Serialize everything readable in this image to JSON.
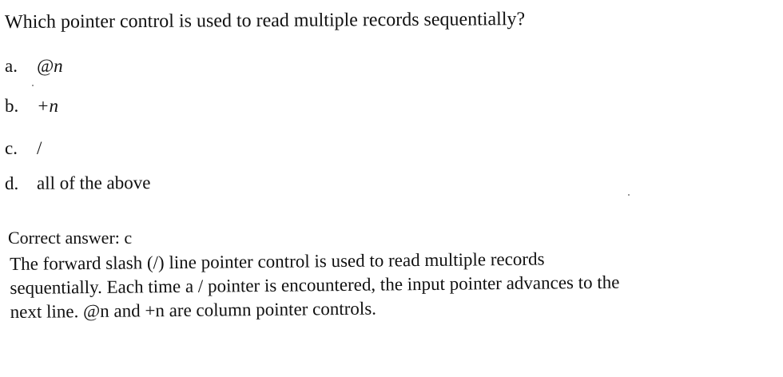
{
  "question": {
    "text": "Which pointer control is used to read multiple records sequentially?"
  },
  "options": [
    {
      "letter": "a.",
      "text": "@n"
    },
    {
      "letter": "b.",
      "text": "+n"
    },
    {
      "letter": "c.",
      "text": "/"
    },
    {
      "letter": "d.",
      "text": "all of the above"
    }
  ],
  "answer": {
    "label": "Correct answer: c"
  },
  "explanation": {
    "lines": [
      "The forward slash (/) line pointer control is used to read multiple records",
      "sequentially. Each time a / pointer is encountered, the input pointer advances to the",
      "next line. @n and +n are column pointer controls."
    ]
  }
}
